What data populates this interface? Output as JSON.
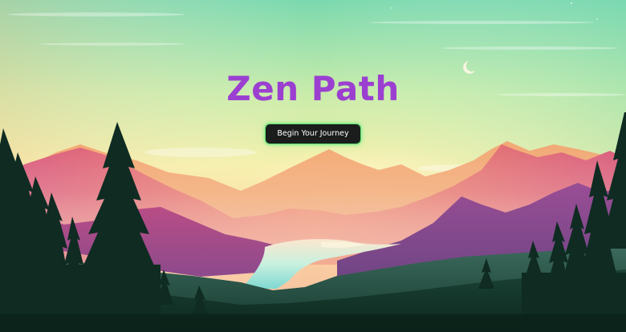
{
  "hero": {
    "title": "Zen Path",
    "cta_label": "Begin Your Journey"
  },
  "colors": {
    "title": "#9b3fd1",
    "button_bg": "#1b1d1c",
    "button_glow": "#60e070",
    "sky_top": "#78dcae",
    "sky_horizon": "#fbdc9f",
    "lake": "#b6eedf",
    "forest": "#0f2f24"
  }
}
